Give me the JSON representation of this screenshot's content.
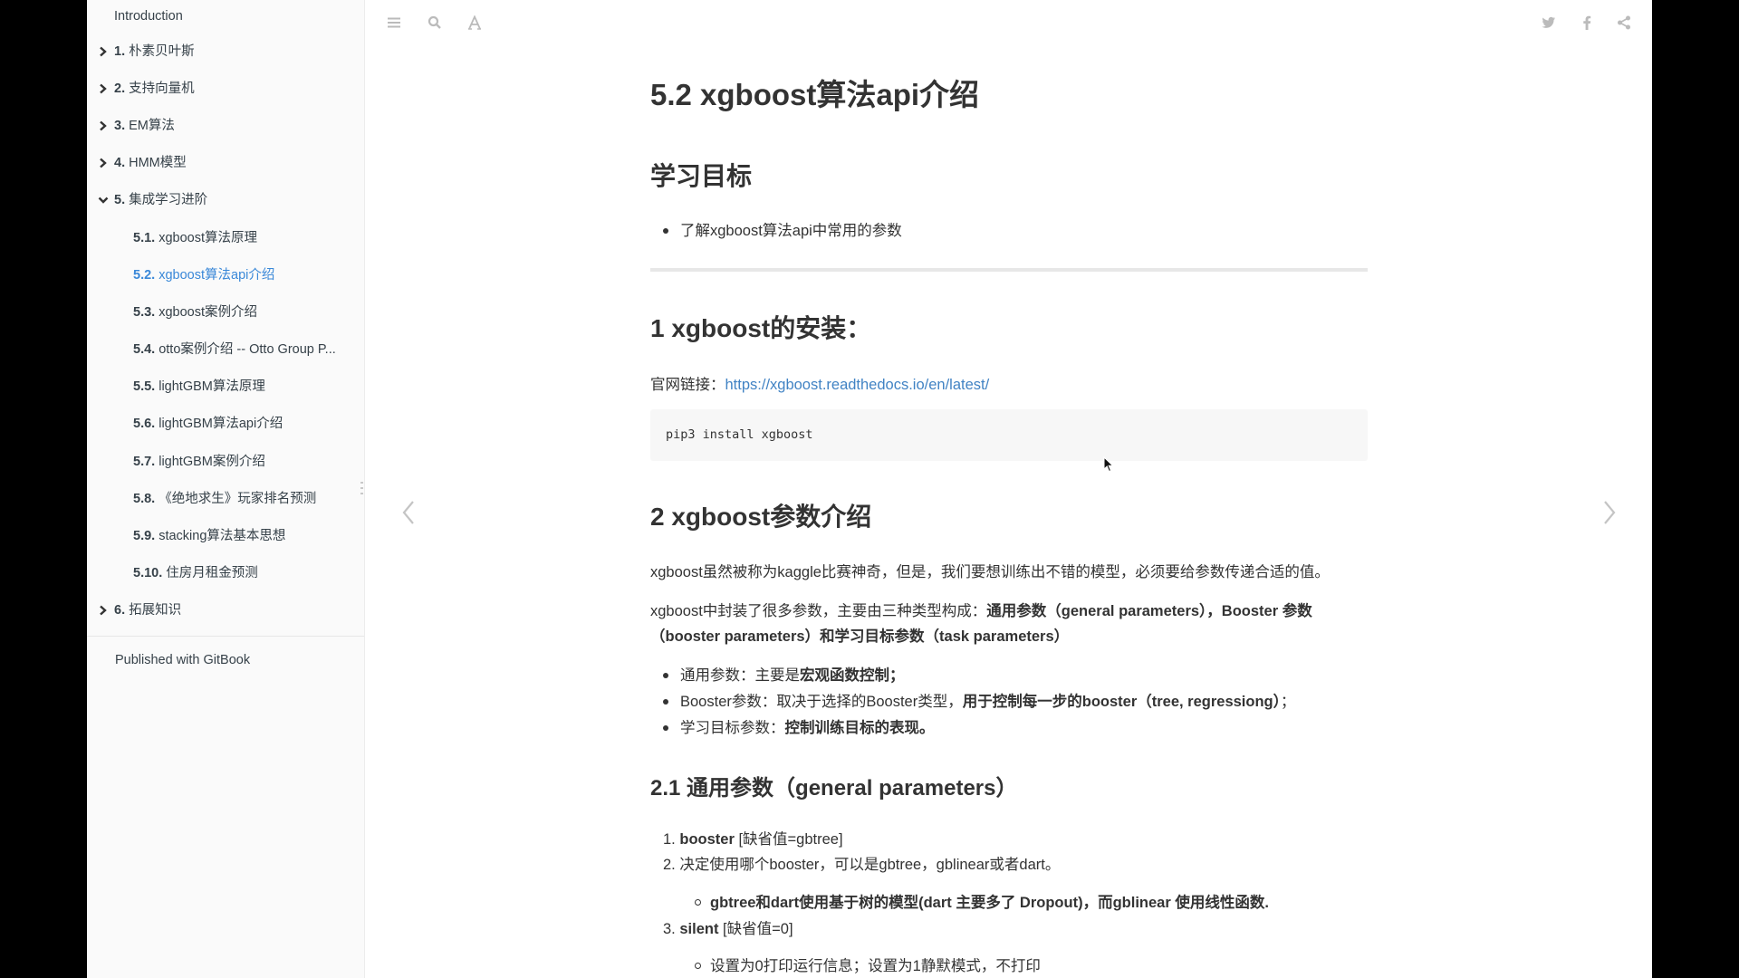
{
  "sidebar": {
    "items": [
      {
        "num": "",
        "label": "Introduction",
        "level": 0,
        "chevron": "none"
      },
      {
        "num": "1.",
        "label": "朴素贝叶斯",
        "level": 0,
        "chevron": "right"
      },
      {
        "num": "2.",
        "label": "支持向量机",
        "level": 0,
        "chevron": "right"
      },
      {
        "num": "3.",
        "label": "EM算法",
        "level": 0,
        "chevron": "right"
      },
      {
        "num": "4.",
        "label": "HMM模型",
        "level": 0,
        "chevron": "right"
      },
      {
        "num": "5.",
        "label": "集成学习进阶",
        "level": 0,
        "chevron": "down"
      },
      {
        "num": "5.1.",
        "label": "xgboost算法原理",
        "level": 1
      },
      {
        "num": "5.2.",
        "label": "xgboost算法api介绍",
        "level": 1,
        "active": true
      },
      {
        "num": "5.3.",
        "label": "xgboost案例介绍",
        "level": 1
      },
      {
        "num": "5.4.",
        "label": "otto案例介绍 -- Otto Group P...",
        "level": 1
      },
      {
        "num": "5.5.",
        "label": "lightGBM算法原理",
        "level": 1
      },
      {
        "num": "5.6.",
        "label": "lightGBM算法api介绍",
        "level": 1
      },
      {
        "num": "5.7.",
        "label": "lightGBM案例介绍",
        "level": 1
      },
      {
        "num": "5.8.",
        "label": "《绝地求生》玩家排名预测",
        "level": 1
      },
      {
        "num": "5.9.",
        "label": "stacking算法基本思想",
        "level": 1
      },
      {
        "num": "5.10.",
        "label": "住房月租金预测",
        "level": 1
      },
      {
        "num": "6.",
        "label": "拓展知识",
        "level": 0,
        "chevron": "right"
      }
    ],
    "footer": "Published with GitBook"
  },
  "header": {
    "left_icons": [
      "menu-icon",
      "search-icon",
      "font-settings-icon"
    ],
    "right_icons": [
      "twitter-icon",
      "facebook-icon",
      "share-icon"
    ]
  },
  "colors": {
    "link": "#4183c4",
    "active": "#3a88d8",
    "sidebar_bg": "#fafafa",
    "text": "#333333"
  },
  "content": {
    "title": "5.2 xgboost算法api介绍",
    "goals_heading": "学习目标",
    "goals": [
      "了解xgboost算法api中常用的参数"
    ],
    "install_heading": "1 xgboost的安装：",
    "link_label": "官网链接：",
    "link_url": "https://xgboost.readthedocs.io/en/latest/",
    "install_code": "pip3 install xgboost",
    "params_heading": "2 xgboost参数介绍",
    "para1": "xgboost虽然被称为kaggle比赛神奇，但是，我们要想训练出不错的模型，必须要给参数传递合适的值。",
    "para2_prefix": "xgboost中封装了很多参数，主要由三种类型构成：",
    "para2_bold_line1": "通用参数（general parameters），Booster 参数",
    "para2_bold_line2": "（booster parameters）和学习目标参数（task parameters）",
    "param_types": [
      {
        "label": "通用参数：主要是",
        "bold": "宏观函数控制；"
      },
      {
        "label": "Booster参数：取决于选择的Booster类型，",
        "bold": "用于控制每一步的booster（tree, regressiong）",
        "tail": "；"
      },
      {
        "label": "学习目标参数：",
        "bold": "控制训练目标的表现。"
      }
    ],
    "general_heading": "2.1 通用参数（general parameters）",
    "general_list": [
      {
        "num": "1.",
        "bold": "booster",
        "text": " [缺省值=gbtree]"
      },
      {
        "num": "2.",
        "bold": "",
        "text": "决定使用哪个booster，可以是gbtree，gblinear或者dart。"
      },
      {
        "num": "3.",
        "bold": "silent",
        "text": " [缺省值=0]"
      }
    ],
    "general_sub": [
      "gbtree和dart使用基于树的模型(dart 主要多了 Dropout)，而gblinear 使用线性函数.",
      "设置为0打印运行信息；设置为1静默模式，不打印"
    ]
  }
}
